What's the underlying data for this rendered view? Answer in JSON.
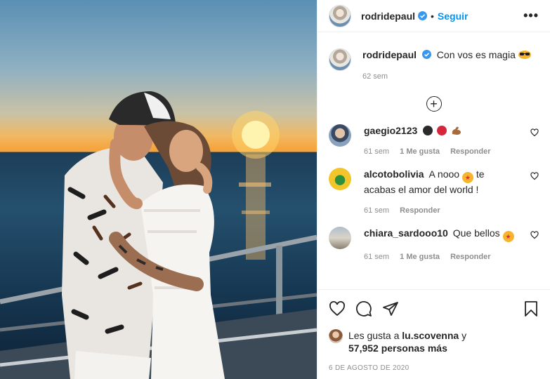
{
  "post": {
    "username": "rodridepaul",
    "follow_label": "Seguir",
    "more_label": "•••",
    "caption": "Con vos es magia",
    "caption_time": "62 sem",
    "load_more_label": "+",
    "comments": [
      {
        "username": "gaegio2123",
        "text": "",
        "time": "61 sem",
        "likes": "1 Me gusta",
        "reply": "Responder",
        "emojis": [
          "black-circle",
          "red-circle",
          "flexed-biceps"
        ]
      },
      {
        "username": "alcotobolivia",
        "text": "A nooo 🤩 te acabas el amor del world !",
        "text_before_emoji": "A nooo",
        "text_after_emoji": "te acabas el amor del world !",
        "time": "61 sem",
        "reply": "Responder",
        "emojis": [
          "star-struck"
        ]
      },
      {
        "username": "chiara_sardooo10",
        "text": "Que bellos",
        "time": "61 sem",
        "likes": "1 Me gusta",
        "reply": "Responder",
        "emojis": [
          "star-struck"
        ]
      }
    ],
    "likes_prefix": "Les gusta a",
    "liked_by_user": "lu.scovenna",
    "likes_connector": "y",
    "likes_count": "57,952 personas más",
    "date": "6 de agosto de 2020"
  },
  "icons": {
    "verified": "verified-badge-icon",
    "like": "heart-icon",
    "comment": "comment-bubble-icon",
    "share": "paper-plane-icon",
    "save": "bookmark-icon",
    "more": "more-horizontal-icon",
    "add": "plus-circle-icon"
  },
  "colors": {
    "accent": "#0095f6",
    "text": "#262626",
    "muted": "#8e8e8e",
    "verified": "#3897f0"
  }
}
